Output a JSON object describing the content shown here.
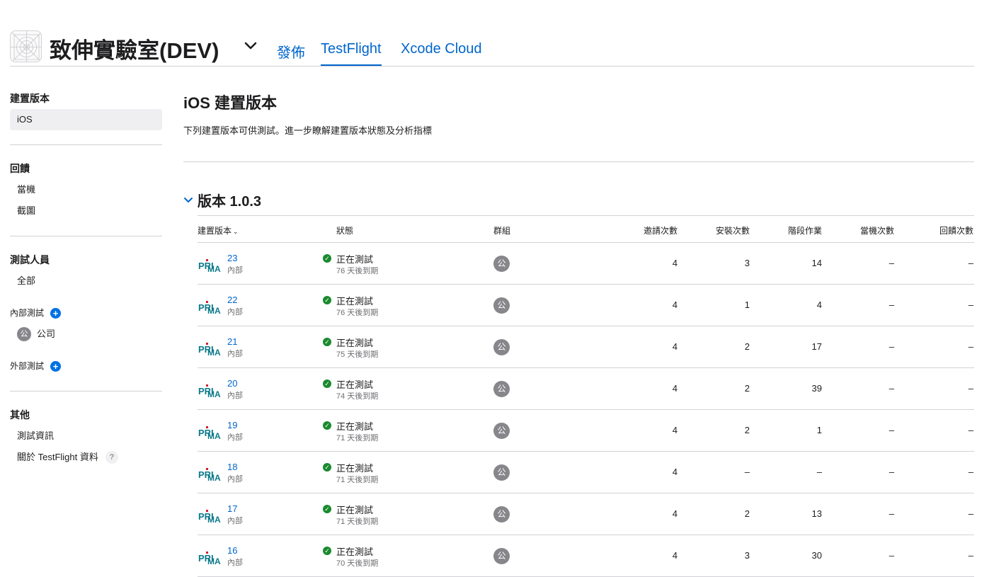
{
  "header": {
    "app_title": "致伸實驗室(DEV)",
    "tabs": [
      {
        "label": "發佈"
      },
      {
        "label": "TestFlight"
      },
      {
        "label": "Xcode Cloud"
      }
    ]
  },
  "sidebar": {
    "builds_heading": "建置版本",
    "builds_item": "iOS",
    "feedback_heading": "回饋",
    "feedback_items": [
      "當機",
      "截圖"
    ],
    "testers_heading": "測試人員",
    "testers_all": "全部",
    "internal_label": "內部測試",
    "internal_group_badge": "公",
    "internal_group": "公司",
    "external_label": "外部測試",
    "other_heading": "其他",
    "other_items": [
      "測試資訊",
      "關於 TestFlight 資料"
    ],
    "help_glyph": "?"
  },
  "main": {
    "title": "iOS 建置版本",
    "description": "下列建置版本可供測試。進一步瞭解建置版本狀態及分析指標",
    "version_heading": "版本 1.0.3"
  },
  "table": {
    "headers": {
      "build": "建置版本",
      "status": "狀態",
      "groups": "群組",
      "invites": "邀請次數",
      "installs": "安裝次數",
      "sessions": "階段作業",
      "crashes": "當機次數",
      "feedback": "回饋次數"
    },
    "rows": [
      {
        "build": "23",
        "type": "內部",
        "status": "正在測試",
        "expiry": "76 天後到期",
        "group": "公",
        "invites": "4",
        "installs": "3",
        "sessions": "14",
        "crashes": "–",
        "feedback": "–"
      },
      {
        "build": "22",
        "type": "內部",
        "status": "正在測試",
        "expiry": "76 天後到期",
        "group": "公",
        "invites": "4",
        "installs": "1",
        "sessions": "4",
        "crashes": "–",
        "feedback": "–"
      },
      {
        "build": "21",
        "type": "內部",
        "status": "正在測試",
        "expiry": "75 天後到期",
        "group": "公",
        "invites": "4",
        "installs": "2",
        "sessions": "17",
        "crashes": "–",
        "feedback": "–"
      },
      {
        "build": "20",
        "type": "內部",
        "status": "正在測試",
        "expiry": "74 天後到期",
        "group": "公",
        "invites": "4",
        "installs": "2",
        "sessions": "39",
        "crashes": "–",
        "feedback": "–"
      },
      {
        "build": "19",
        "type": "內部",
        "status": "正在測試",
        "expiry": "71 天後到期",
        "group": "公",
        "invites": "4",
        "installs": "2",
        "sessions": "1",
        "crashes": "–",
        "feedback": "–"
      },
      {
        "build": "18",
        "type": "內部",
        "status": "正在測試",
        "expiry": "71 天後到期",
        "group": "公",
        "invites": "4",
        "installs": "–",
        "sessions": "–",
        "crashes": "–",
        "feedback": "–"
      },
      {
        "build": "17",
        "type": "內部",
        "status": "正在測試",
        "expiry": "71 天後到期",
        "group": "公",
        "invites": "4",
        "installs": "2",
        "sessions": "13",
        "crashes": "–",
        "feedback": "–"
      },
      {
        "build": "16",
        "type": "內部",
        "status": "正在測試",
        "expiry": "70 天後到期",
        "group": "公",
        "invites": "4",
        "installs": "3",
        "sessions": "30",
        "crashes": "–",
        "feedback": "–"
      }
    ]
  },
  "colors": {
    "accent": "#0066cc",
    "status_green": "#1a8a2e",
    "badge_gray": "#86868b"
  },
  "icons": {
    "app": "app-placeholder-icon",
    "title_dropdown": "chevron-down-icon",
    "version_toggle": "chevron-down-icon",
    "add": "plus-circle-icon",
    "status": "checkmark-circle-icon",
    "help": "question-mark-icon",
    "build_thumb": "primax-logo-icon"
  }
}
